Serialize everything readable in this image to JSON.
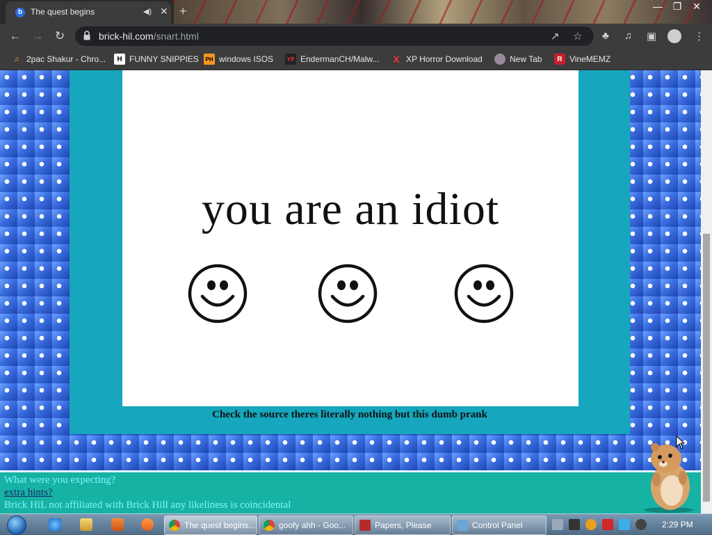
{
  "tab": {
    "title": "The quest begins"
  },
  "address": {
    "host": "brick-hil.com",
    "path": "/snart.html"
  },
  "bookmarks": [
    {
      "label": "2pac Shakur - Chro...",
      "icon": "music-icon"
    },
    {
      "label": "FUNNY SNIPPIES",
      "icon": "h-logo-icon"
    },
    {
      "label": "windows ISOS",
      "icon": "ph-logo-icon"
    },
    {
      "label": "EndermanCH/Malw...",
      "icon": "yt-logo-icon"
    },
    {
      "label": "XP Horror Download",
      "icon": "x-icon"
    },
    {
      "label": "New Tab",
      "icon": "globe-icon"
    },
    {
      "label": "VineMEMZ",
      "icon": "r-logo-icon"
    }
  ],
  "page": {
    "headline": "you are an idiot",
    "caption": "Check the source theres literally nothing but this dumb prank",
    "footer": {
      "line1": "What were you expecting?",
      "link": "extra hints?",
      "line3": "Brick HiL not affiliated with Brick Hill any likeliness is coincidental"
    }
  },
  "taskbar": {
    "items": [
      {
        "label": "The quest begins..."
      },
      {
        "label": "goofy ahh - Goo..."
      },
      {
        "label": "Papers, Please"
      },
      {
        "label": "Control Panel"
      }
    ],
    "clock": "2:29 PM"
  }
}
